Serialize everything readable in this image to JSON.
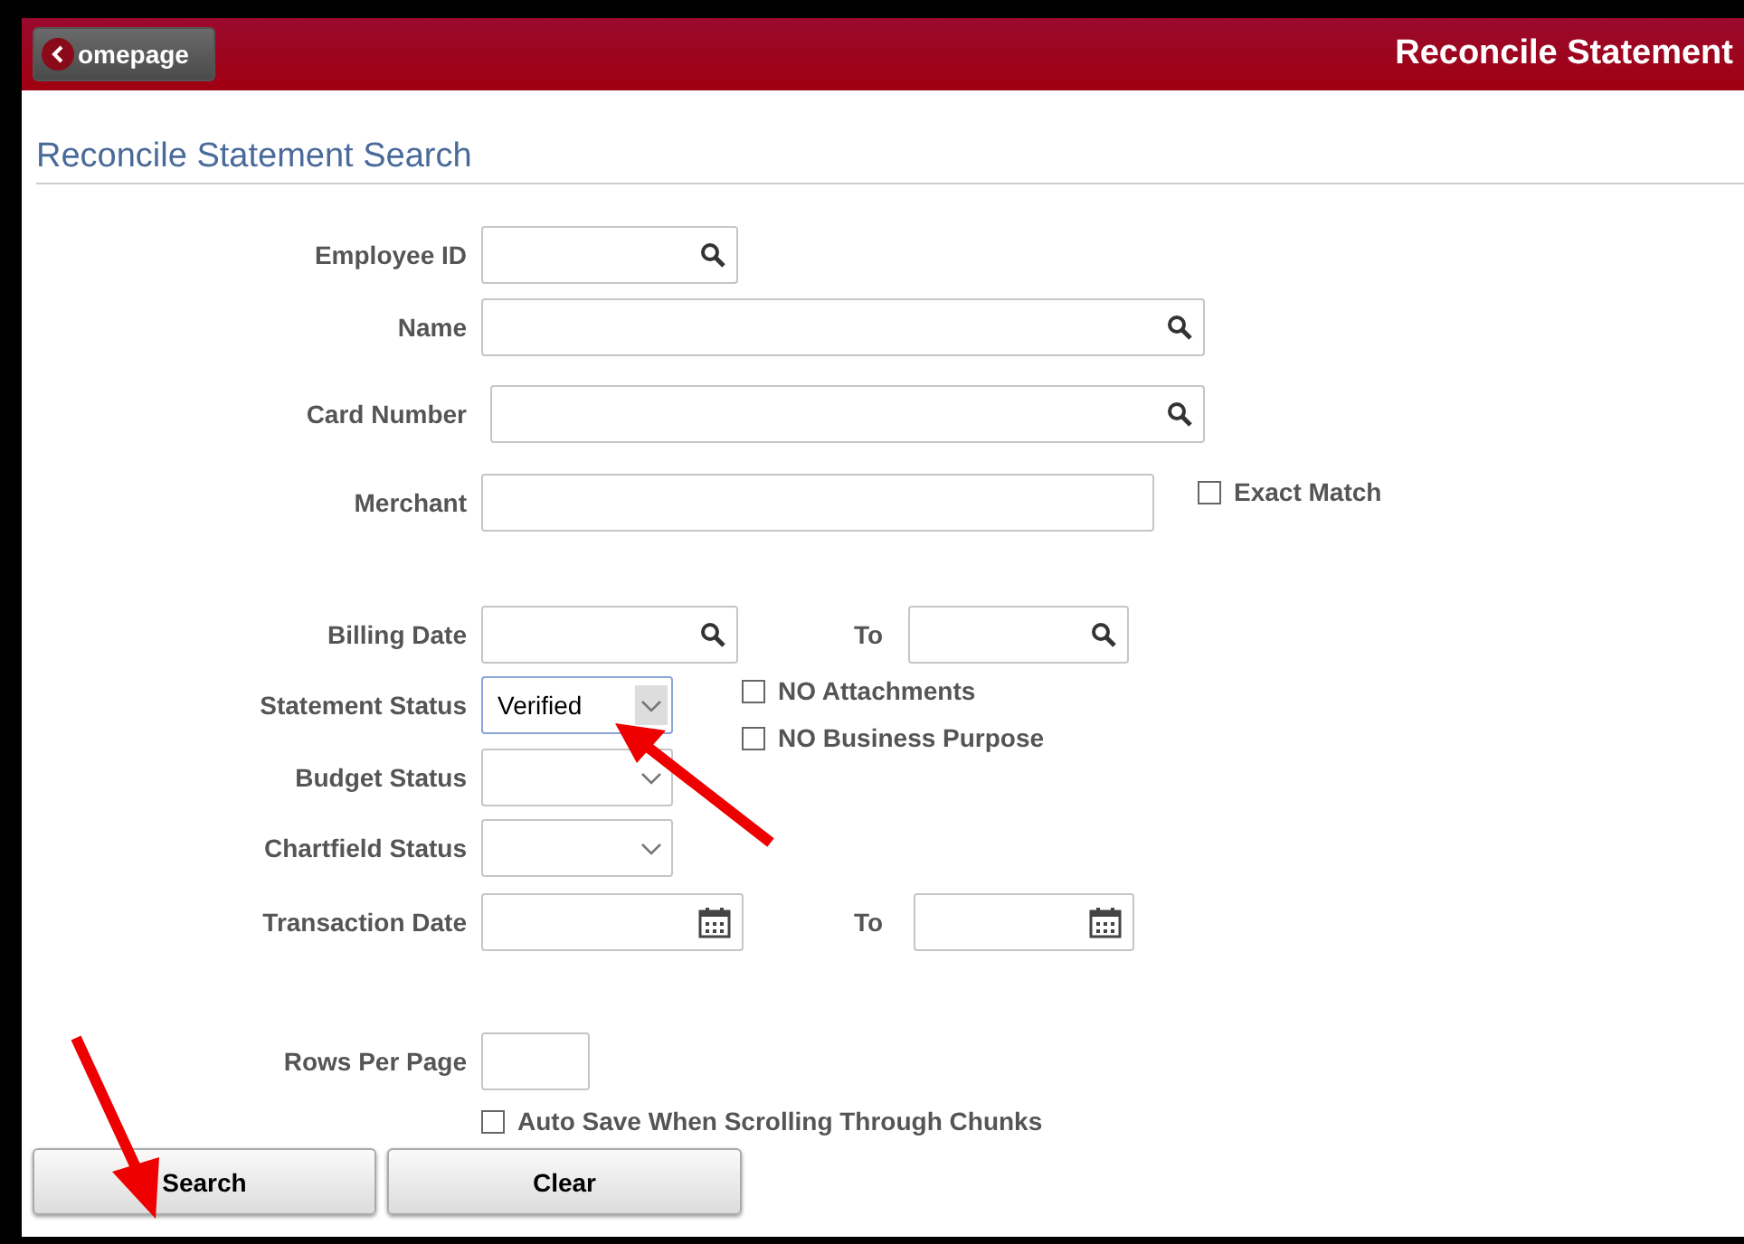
{
  "header": {
    "back_button": "omepage",
    "title": "Reconcile Statement"
  },
  "page_title": "Reconcile Statement Search",
  "fields": [
    {
      "kind": "lookup",
      "label": "Employee ID"
    },
    {
      "kind": "lookup",
      "label": "Name"
    },
    {
      "kind": "lookup",
      "label": "Card Number"
    },
    {
      "kind": "text",
      "label": "Merchant",
      "checkboxes": [
        {
          "label": "Exact Match",
          "checked": false
        }
      ]
    },
    {
      "kind": "lookup_range",
      "label": "Billing Date",
      "to_label": "To"
    },
    {
      "kind": "select",
      "label": "Statement Status",
      "value": "Verified",
      "focused": true,
      "checkboxes": [
        {
          "label": "NO Attachments",
          "checked": false
        },
        {
          "label": "NO Business Purpose",
          "checked": false
        }
      ]
    },
    {
      "kind": "select",
      "label": "Budget Status",
      "focused": false
    },
    {
      "kind": "select",
      "label": "Chartfield Status",
      "focused": false
    },
    {
      "kind": "date_range",
      "label": "Transaction Date",
      "to_label": "To"
    },
    {
      "kind": "number",
      "label": "Rows Per Page"
    }
  ],
  "auto_save": {
    "label": "Auto Save When Scrolling Through Chunks",
    "checked": false
  },
  "buttons": [
    "Search",
    "Clear"
  ]
}
